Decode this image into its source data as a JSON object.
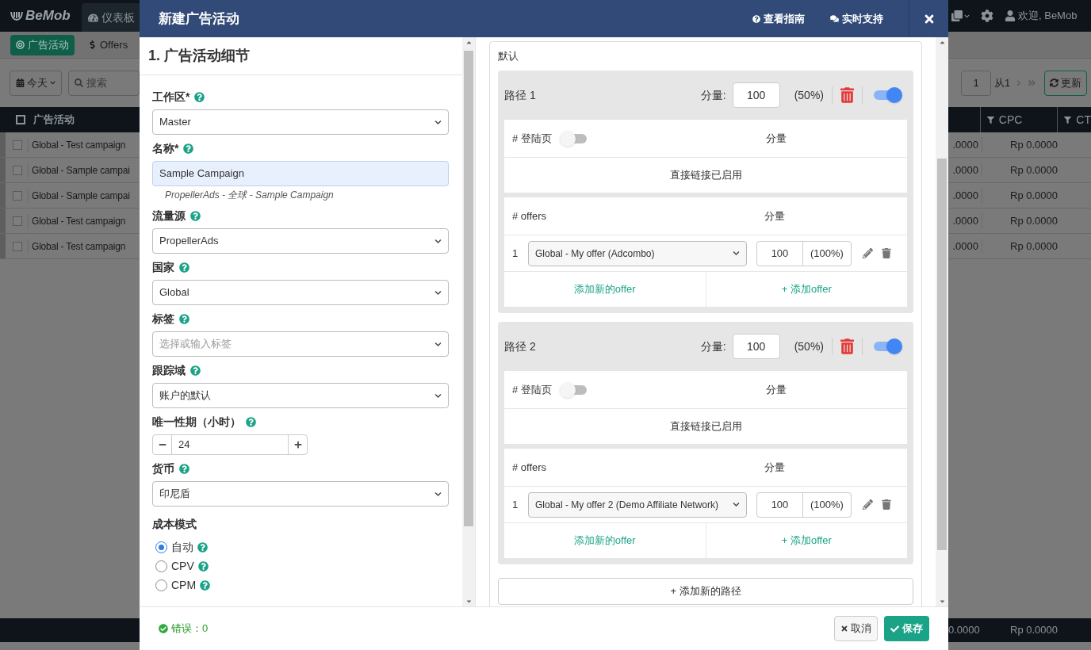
{
  "app_left": {
    "logo": "BeMob",
    "nav_tab": "仪表板",
    "sub_tabs": [
      {
        "label": "广告活动",
        "selected": true
      },
      {
        "label": "Offers",
        "selected": false
      }
    ],
    "date_filter": "今天",
    "search": {
      "placeholder": "搜索"
    },
    "column": "广告活动",
    "all_checked": false,
    "rows": [
      {
        "name": "Global - Test campaign",
        "checked": false
      },
      {
        "name": "Global - Sample campai",
        "checked": false
      },
      {
        "name": "Global - Sample campai",
        "checked": false
      },
      {
        "name": "Global - Test campaign",
        "checked": false
      },
      {
        "name": "Global - Test campaign",
        "checked": false
      }
    ]
  },
  "app_right": {
    "user": "欢迎, BeMob",
    "page": "1",
    "page_total": "从1",
    "refresh": "更新",
    "columns": [
      "CPC",
      "CT"
    ],
    "rows": [
      {
        "column_1": ".0000",
        "cpc": "Rp 0.0000"
      },
      {
        "column_1": ".0000",
        "cpc": "Rp 0.0000"
      },
      {
        "column_1": ".0000",
        "cpc": "Rp 0.0000"
      },
      {
        "column_1": ".0000",
        "cpc": "Rp 0.0000"
      },
      {
        "column_1": ".0000",
        "cpc": "Rp 0.0000"
      }
    ],
    "totals": [
      "0.0000",
      "Rp 0.0000"
    ]
  },
  "modal": {
    "title": "新建广告活动",
    "links": [
      "查看指南",
      "实时支持"
    ],
    "section_title": "1. 广告活动细节",
    "fields": [
      {
        "kind": "select",
        "label": "工作区*",
        "value": "Master"
      },
      {
        "kind": "text",
        "label": "名称*",
        "value": "Sample Campaign",
        "hint": "PropellerAds - 全球 - Sample Campaign"
      },
      {
        "kind": "select",
        "label": "流量源",
        "value": "PropellerAds"
      },
      {
        "kind": "select",
        "label": "国家",
        "value": "Global"
      },
      {
        "kind": "select",
        "label": "标签",
        "placeholder": "选择或输入标签"
      },
      {
        "kind": "select",
        "label": "跟踪域",
        "value": "账户的默认"
      },
      {
        "kind": "stepper",
        "label": "唯一性期（小时）",
        "value": "24"
      },
      {
        "kind": "select",
        "label": "货币",
        "value": "印尼盾"
      }
    ],
    "cost_model": {
      "label": "成本模式",
      "options": [
        {
          "label": "自动",
          "selected": true
        },
        {
          "label": "CPV",
          "selected": false
        },
        {
          "label": "CPM",
          "selected": false
        }
      ]
    },
    "default_label": "默认",
    "paths": [
      {
        "name": "路径 1",
        "weight_label": "分量:",
        "weight": "100",
        "share": "(50%)",
        "on": true,
        "landers": {
          "label": "# 登陆页",
          "on": false,
          "weight_label": "分量",
          "message": "直接链接已启用"
        },
        "offers": {
          "label": "# offers",
          "weight_label": "分量",
          "rows": [
            {
              "index": "1",
              "offer": "Global - My offer (Adcombo)",
              "weight": "100",
              "share": "(100%)"
            }
          ],
          "actions": [
            "添加新的offer",
            "+ 添加offer"
          ]
        }
      },
      {
        "name": "路径 2",
        "weight_label": "分量:",
        "weight": "100",
        "share": "(50%)",
        "on": true,
        "landers": {
          "label": "# 登陆页",
          "on": false,
          "weight_label": "分量",
          "message": "直接链接已启用"
        },
        "offers": {
          "label": "# offers",
          "weight_label": "分量",
          "rows": [
            {
              "index": "1",
              "offer": "Global - My offer 2 (Demo Affiliate Network)",
              "weight": "100",
              "share": "(100%)"
            }
          ],
          "actions": [
            "添加新的offer",
            "+ 添加offer"
          ]
        }
      }
    ],
    "add_path": "+ 添加新的路径",
    "errors": "错误：0",
    "cancel": "取消",
    "save": "保存"
  }
}
